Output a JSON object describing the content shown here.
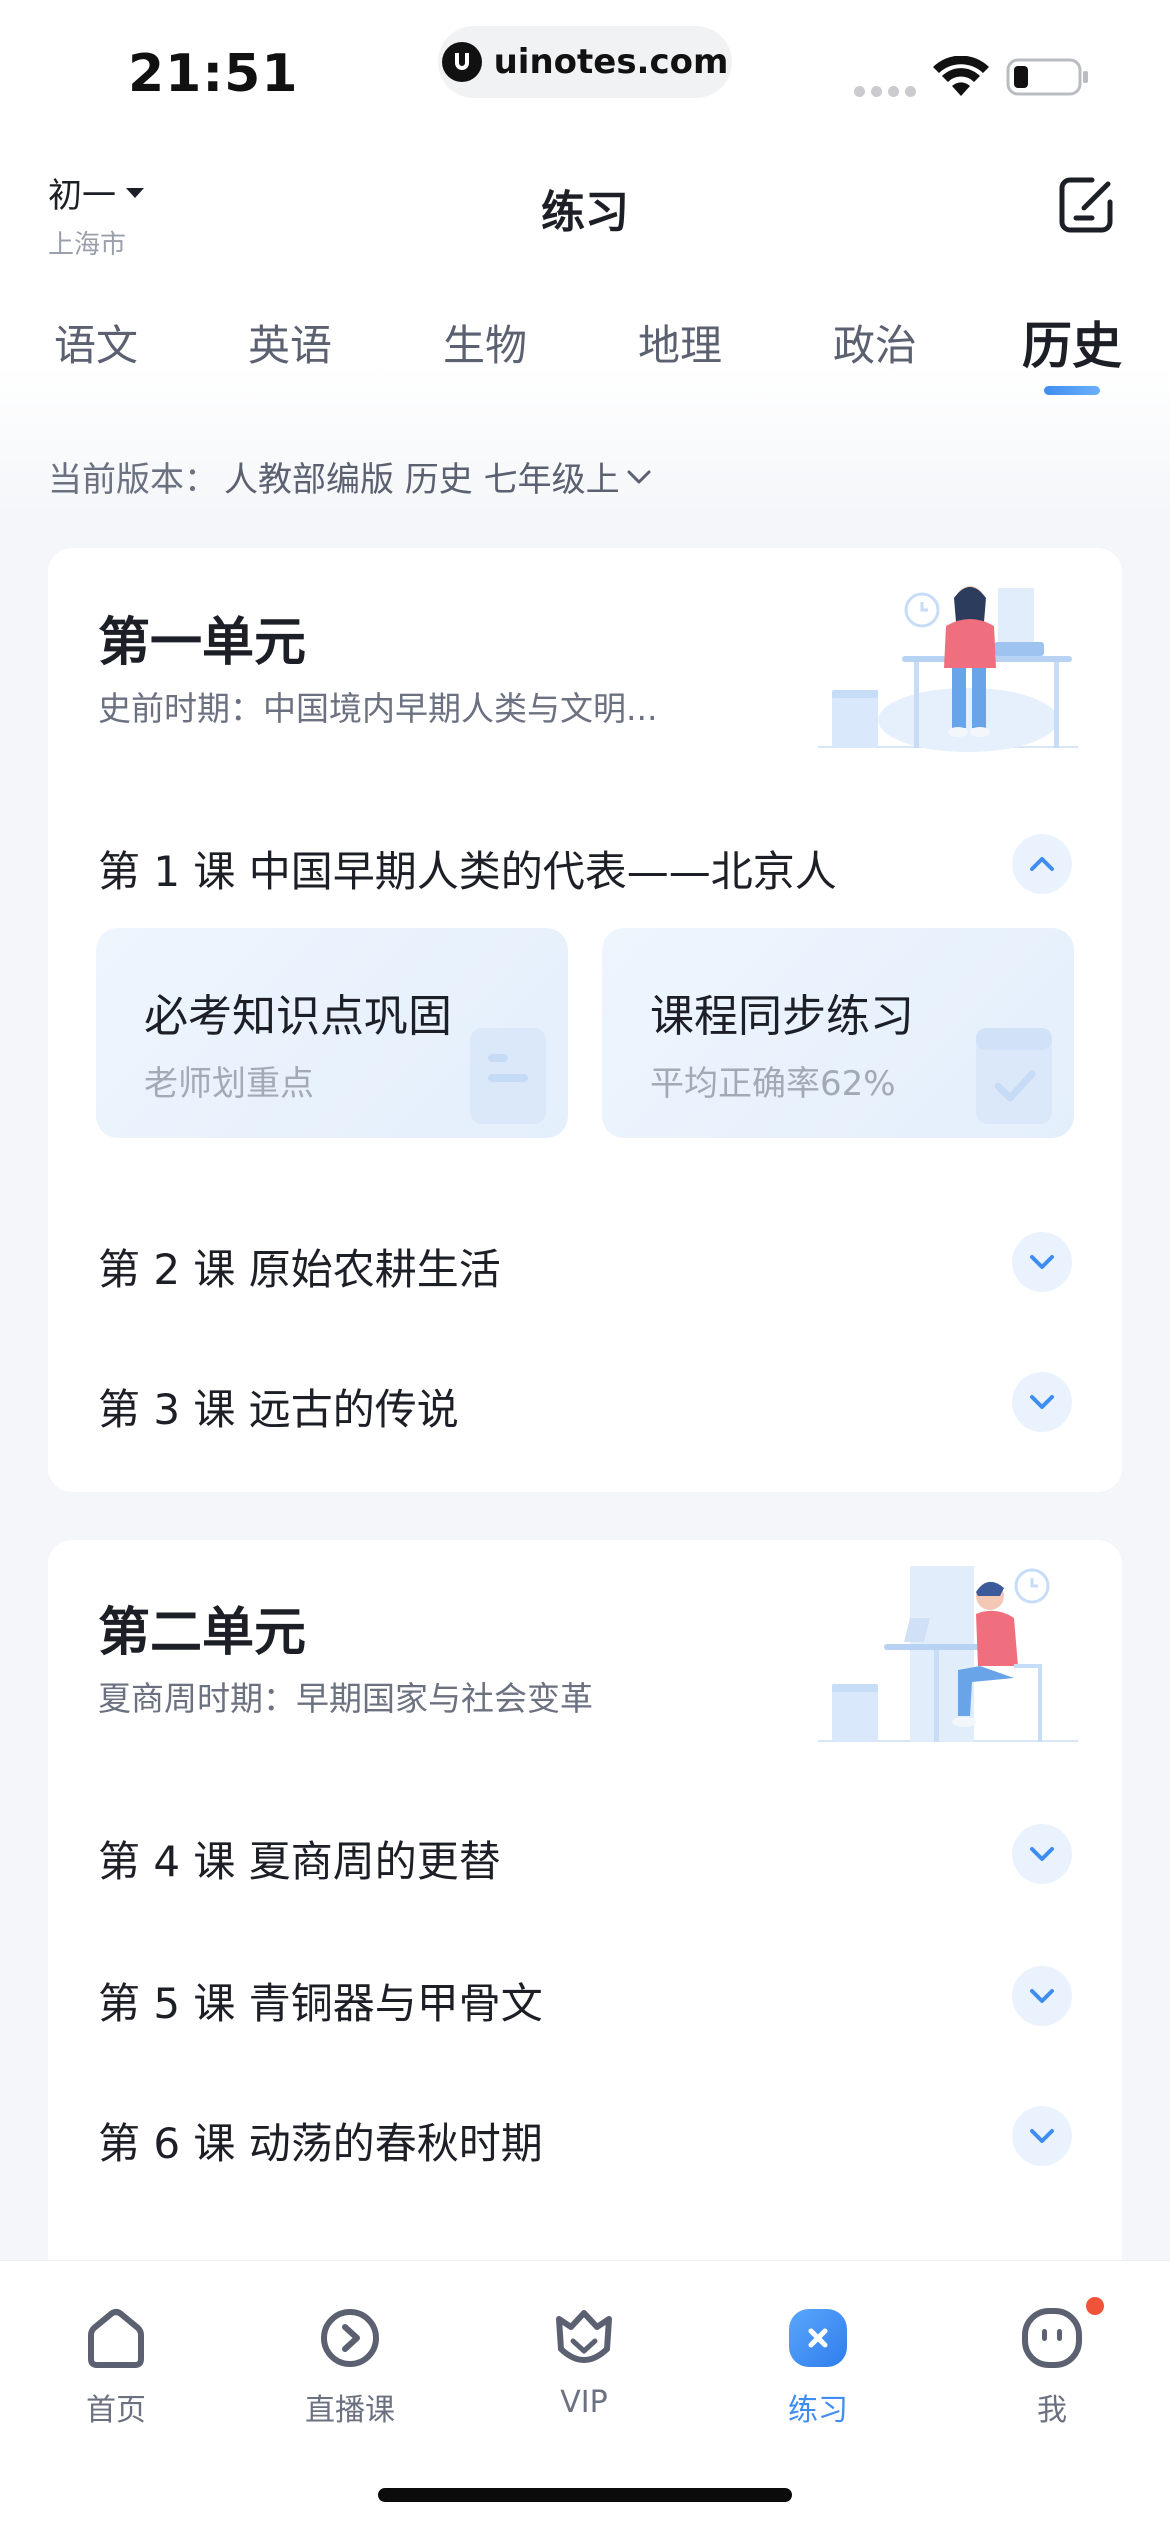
{
  "status_bar": {
    "time": "21:51",
    "url": "uinotes.com"
  },
  "header": {
    "grade": "初一",
    "city": "上海市",
    "title": "练习"
  },
  "tabs": [
    {
      "label": "语文",
      "active": false
    },
    {
      "label": "英语",
      "active": false
    },
    {
      "label": "生物",
      "active": false
    },
    {
      "label": "地理",
      "active": false
    },
    {
      "label": "政治",
      "active": false
    },
    {
      "label": "历史",
      "active": true
    }
  ],
  "version": {
    "label": "当前版本：",
    "value": "人教部编版 历史 七年级上"
  },
  "units": [
    {
      "title": "第一单元",
      "subtitle": "史前时期：中国境内早期人类与文明...",
      "lessons": [
        {
          "title": "第 1 课  中国早期人类的代表——北京人",
          "expanded": true
        },
        {
          "title": "第 2 课  原始农耕生活",
          "expanded": false
        },
        {
          "title": "第 3 课  远古的传说",
          "expanded": false
        }
      ],
      "practice_cards": [
        {
          "title": "必考知识点巩固",
          "desc": "老师划重点"
        },
        {
          "title": "课程同步练习",
          "desc": "平均正确率62%"
        }
      ]
    },
    {
      "title": "第二单元",
      "subtitle": "夏商周时期：早期国家与社会变革",
      "lessons": [
        {
          "title": "第 4 课  夏商周的更替",
          "expanded": false
        },
        {
          "title": "第 5 课  青铜器与甲骨文",
          "expanded": false
        },
        {
          "title": "第 6 课  动荡的春秋时期",
          "expanded": false
        }
      ]
    }
  ],
  "bottom_nav": [
    {
      "label": "首页",
      "icon": "home-icon"
    },
    {
      "label": "直播课",
      "icon": "live-icon"
    },
    {
      "label": "VIP",
      "icon": "vip-icon"
    },
    {
      "label": "练习",
      "icon": "practice-icon",
      "active": true
    },
    {
      "label": "我",
      "icon": "profile-icon",
      "badge": true
    }
  ],
  "colors": {
    "accent": "#3f8df0",
    "badge": "#f0533a",
    "background": "#f4f6f9"
  }
}
